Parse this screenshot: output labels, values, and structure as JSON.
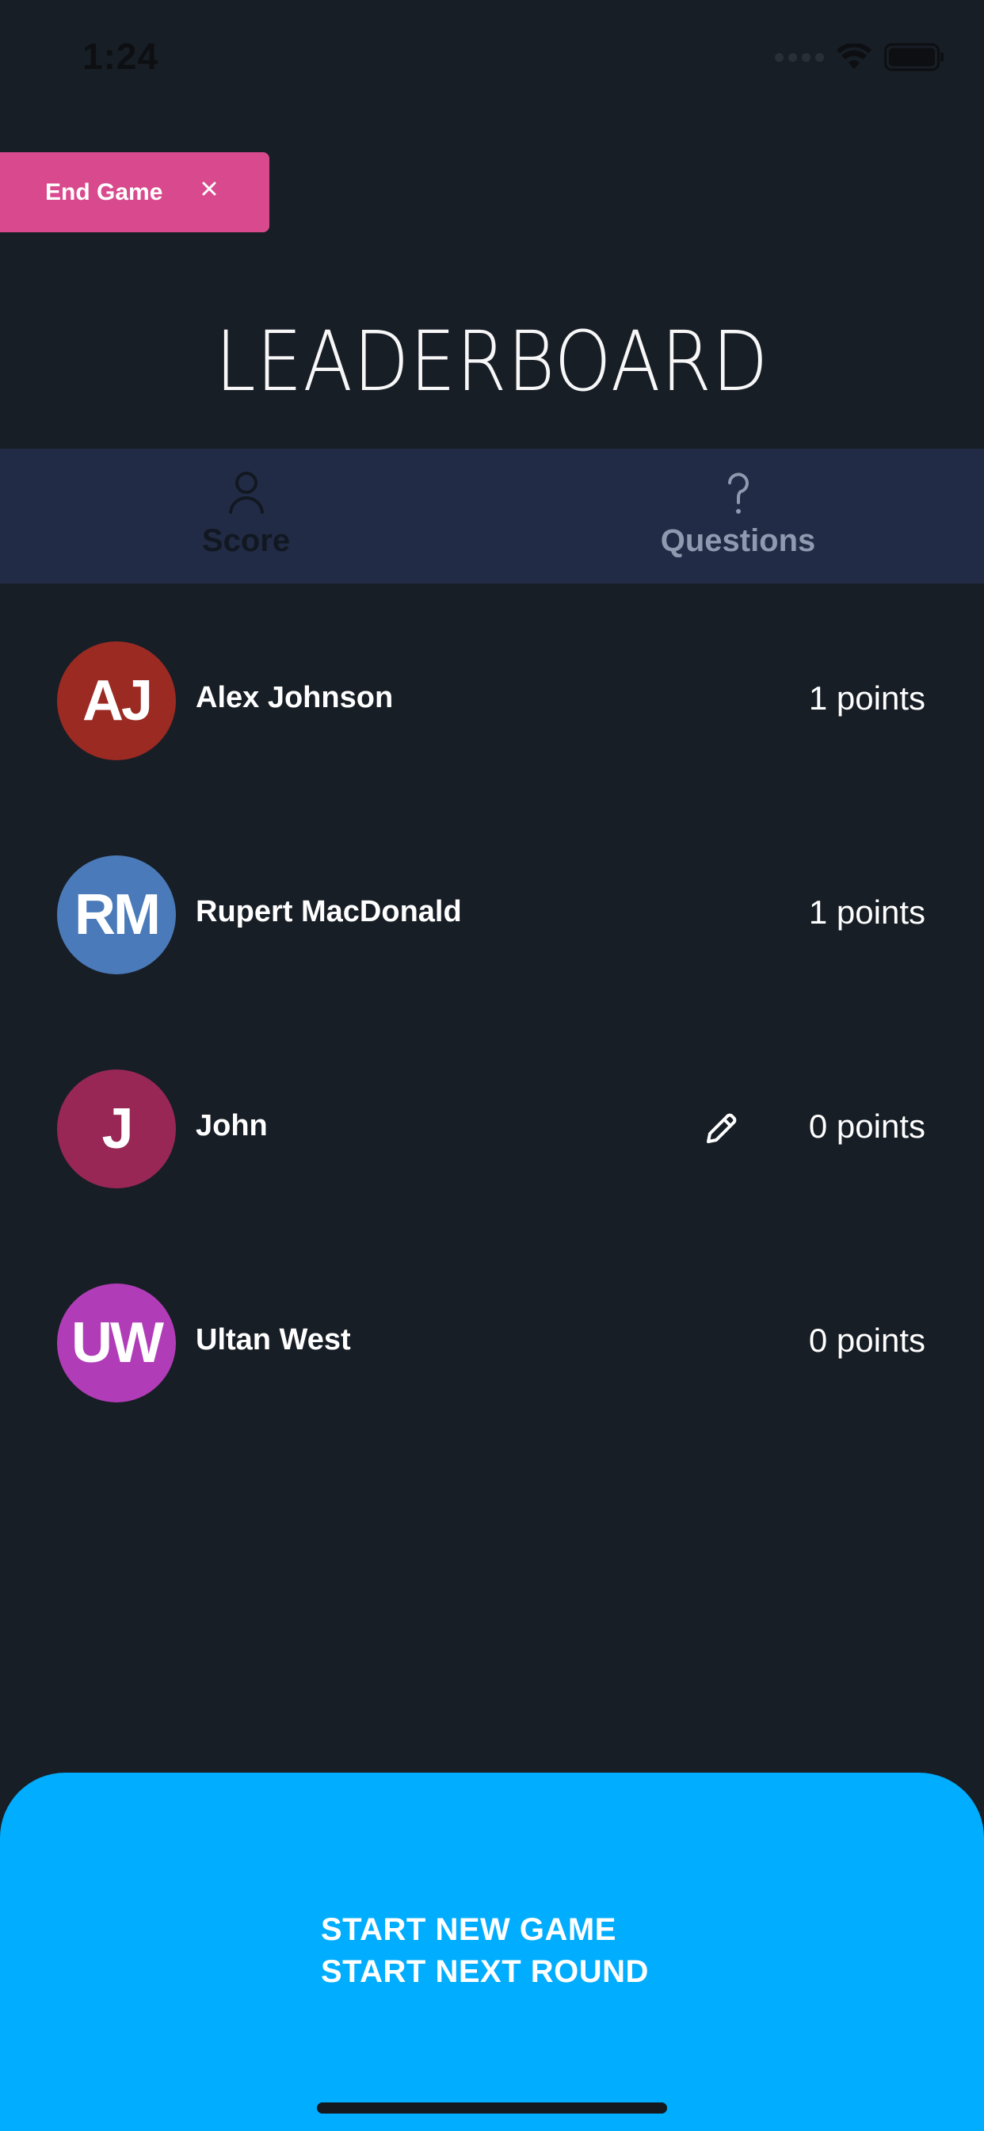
{
  "status_bar": {
    "time": "1:24",
    "icons": [
      "cellular-signal-icon",
      "wifi-icon",
      "battery-icon"
    ]
  },
  "end_game": {
    "label": "End Game",
    "icon": "close-icon"
  },
  "title": "LEADERBOARD",
  "tabs": [
    {
      "label": "Score",
      "icon": "person-icon",
      "selected": true
    },
    {
      "label": "Questions",
      "icon": "question-mark-icon",
      "selected": false
    }
  ],
  "players": [
    {
      "initials": "AJ",
      "name": "Alex Johnson",
      "points": "1 points",
      "avatar_color": "#9b2a22",
      "editable": false
    },
    {
      "initials": "RM",
      "name": "Rupert MacDonald",
      "points": "1 points",
      "avatar_color": "#4a7ab9",
      "editable": false
    },
    {
      "initials": "J",
      "name": "John",
      "points": "0 points",
      "avatar_color": "#982756",
      "editable": true
    },
    {
      "initials": "UW",
      "name": "Ultan West",
      "points": "0 points",
      "avatar_color": "#b13cb7",
      "editable": false
    }
  ],
  "bottom_panel": {
    "actions": [
      "START NEW GAME",
      "START NEXT ROUND"
    ],
    "color": "#00adff"
  },
  "colors": {
    "background": "#181e26",
    "tab_bar": "#212b45",
    "end_game": "#d84a8d"
  }
}
